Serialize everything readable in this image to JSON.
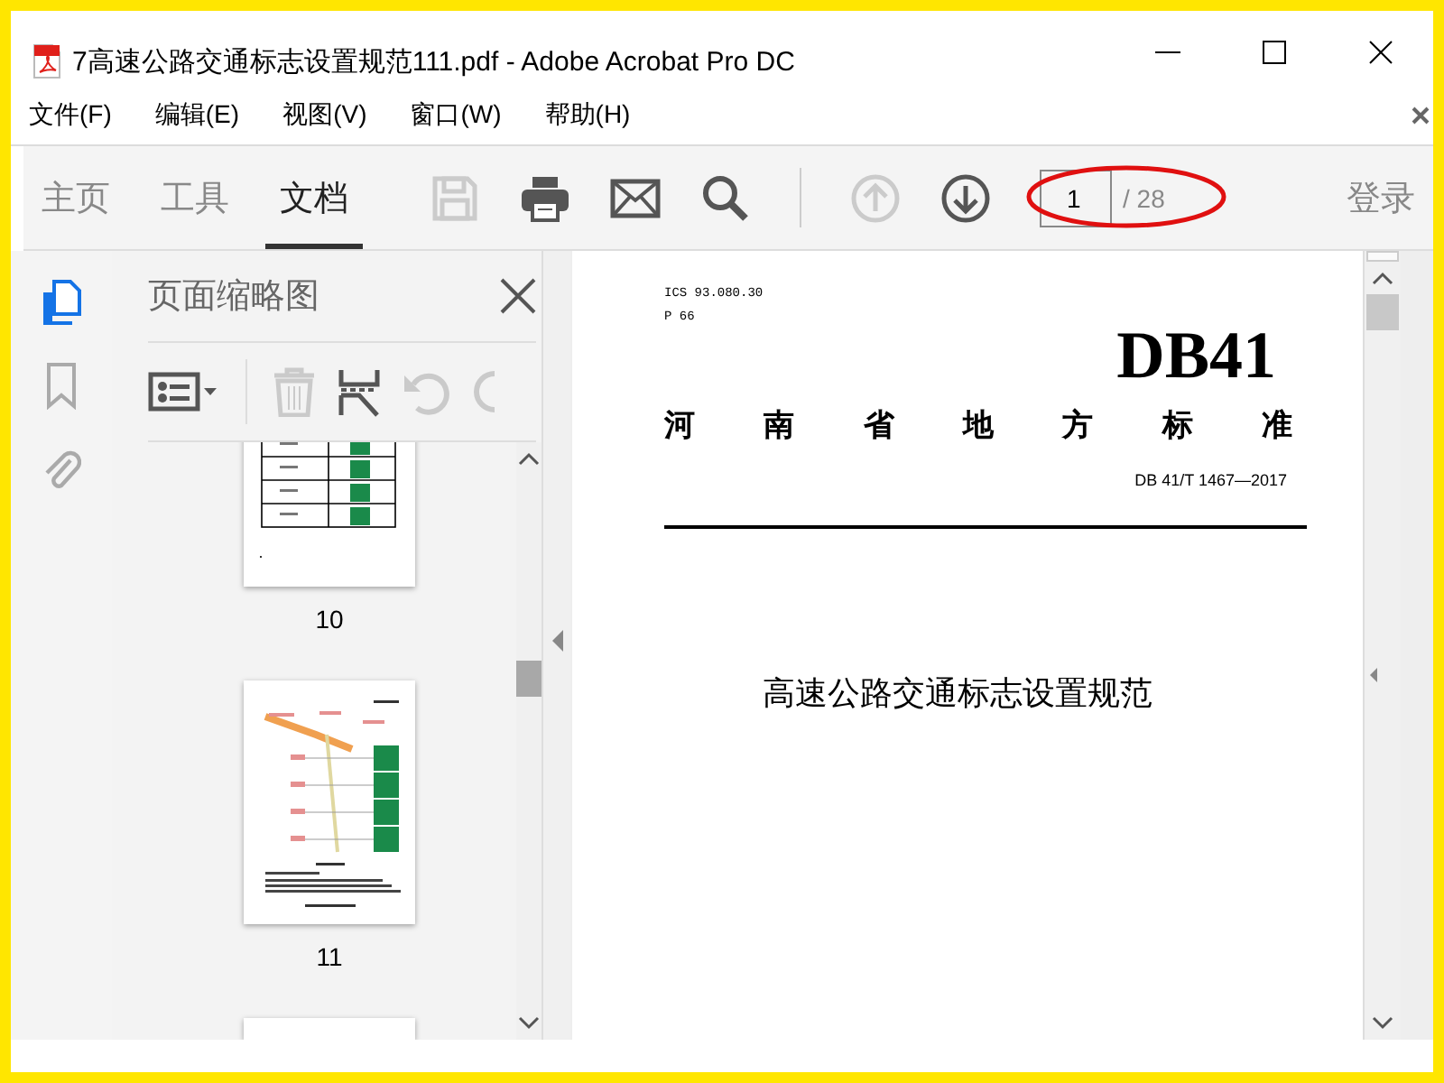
{
  "window": {
    "title": "7高速公路交通标志设置规范111.pdf - Adobe Acrobat Pro DC"
  },
  "menu": [
    "文件(F)",
    "编辑(E)",
    "视图(V)",
    "窗口(W)",
    "帮助(H)"
  ],
  "tabs": [
    {
      "label": "主页",
      "selected": false
    },
    {
      "label": "工具",
      "selected": false
    },
    {
      "label": "文档",
      "selected": true
    }
  ],
  "tools": [
    {
      "kind": "save",
      "disabled": true
    },
    {
      "kind": "print",
      "disabled": false
    },
    {
      "kind": "mail",
      "disabled": false
    },
    {
      "kind": "search",
      "disabled": false
    },
    {
      "kind": "separator"
    },
    {
      "kind": "prev",
      "disabled": true
    },
    {
      "kind": "next",
      "disabled": false
    }
  ],
  "page_nav": {
    "current": "1",
    "total": "/ 28"
  },
  "sign_in": "登录",
  "side_tools": [
    {
      "kind": "pages",
      "selected": true
    },
    {
      "kind": "bookmark",
      "selected": false
    },
    {
      "kind": "attachment",
      "selected": false
    }
  ],
  "thumbnail_panel": {
    "title": "页面缩略图",
    "tools": [
      {
        "kind": "options",
        "disabled": false
      },
      {
        "kind": "separator"
      },
      {
        "kind": "delete",
        "disabled": true
      },
      {
        "kind": "extract",
        "disabled": false
      },
      {
        "kind": "rotate_left",
        "disabled": true
      },
      {
        "kind": "rotate_right",
        "disabled": true
      }
    ],
    "thumbnails": [
      {
        "kind": "table",
        "label": "10"
      },
      {
        "kind": "diagram",
        "label": "11"
      },
      {
        "kind": "partial"
      }
    ]
  },
  "document": {
    "ics": "ICS 93.080.30",
    "class": "P 66",
    "code": "DB41",
    "standard_type": [
      "河",
      "南",
      "省",
      "地",
      "方",
      "标",
      "准"
    ],
    "number": "DB 41/T 1467—2017",
    "title": "高速公路交通标志设置规范"
  }
}
